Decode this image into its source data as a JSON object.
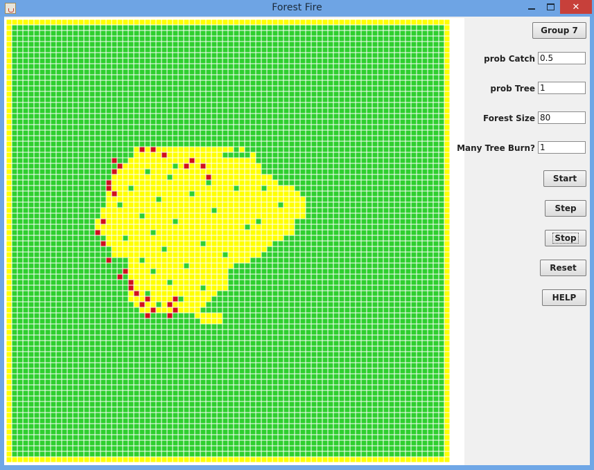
{
  "window": {
    "title": "Forest Fire",
    "close_glyph": "✕"
  },
  "icons": {
    "app": "java-cup-icon",
    "minimize": "minimize-icon",
    "maximize": "maximize-icon",
    "close": "close-icon"
  },
  "colors": {
    "tree": "#2fcf2f",
    "empty": "#ffff00",
    "burning": "#d0101c",
    "grid_line": "#ffffff"
  },
  "controls": {
    "group_button": "Group 7",
    "prob_catch": {
      "label": "prob Catch",
      "value": "0.5"
    },
    "prob_tree": {
      "label": "prob Tree",
      "value": "1"
    },
    "forest_size": {
      "label": "Forest Size",
      "value": "80"
    },
    "many_tree_burn": {
      "label": "Many Tree Burn?",
      "value": "1"
    },
    "start_button": "Start",
    "step_button": "Step",
    "stop_button": "Stop",
    "reset_button": "Reset",
    "help_button": "HELP"
  },
  "forest": {
    "size": 80,
    "burnt_rows": [
      [
        23,
        23,
        40,
        42
      ],
      [
        24,
        23,
        38,
        44
      ],
      [
        25,
        22,
        44
      ],
      [
        26,
        21,
        45
      ],
      [
        27,
        19,
        45
      ],
      [
        28,
        19,
        47
      ],
      [
        29,
        18,
        48
      ],
      [
        30,
        18,
        51
      ],
      [
        31,
        18,
        52
      ],
      [
        32,
        18,
        53
      ],
      [
        33,
        18,
        53
      ],
      [
        34,
        17,
        53
      ],
      [
        35,
        17,
        53
      ],
      [
        36,
        16,
        51
      ],
      [
        37,
        16,
        51
      ],
      [
        38,
        17,
        51
      ],
      [
        39,
        18,
        49
      ],
      [
        40,
        18,
        47
      ],
      [
        41,
        19,
        46
      ],
      [
        42,
        19,
        45
      ],
      [
        43,
        22,
        43
      ],
      [
        44,
        22,
        40
      ],
      [
        45,
        22,
        39
      ],
      [
        46,
        22,
        39
      ],
      [
        47,
        22,
        39
      ],
      [
        48,
        22,
        39
      ],
      [
        49,
        22,
        37
      ],
      [
        50,
        22,
        36
      ],
      [
        51,
        23,
        35
      ],
      [
        52,
        24,
        34
      ],
      [
        53,
        34,
        38
      ],
      [
        54,
        35,
        38
      ]
    ],
    "burnt_trees": [
      [
        26,
        30
      ],
      [
        27,
        25
      ],
      [
        28,
        29
      ],
      [
        29,
        36
      ],
      [
        30,
        22
      ],
      [
        30,
        41
      ],
      [
        31,
        33
      ],
      [
        32,
        27
      ],
      [
        33,
        20
      ],
      [
        34,
        37
      ],
      [
        35,
        24
      ],
      [
        36,
        30
      ],
      [
        37,
        43
      ],
      [
        38,
        26
      ],
      [
        39,
        21
      ],
      [
        40,
        35
      ],
      [
        41,
        28
      ],
      [
        42,
        39
      ],
      [
        43,
        24
      ],
      [
        44,
        32
      ],
      [
        45,
        26
      ],
      [
        47,
        29
      ],
      [
        48,
        35
      ],
      [
        49,
        25
      ],
      [
        50,
        31
      ],
      [
        51,
        27
      ],
      [
        52,
        30
      ],
      [
        30,
        46
      ],
      [
        33,
        49
      ],
      [
        36,
        45
      ]
    ],
    "burning": [
      [
        23,
        24
      ],
      [
        23,
        26
      ],
      [
        24,
        28
      ],
      [
        25,
        19
      ],
      [
        25,
        33
      ],
      [
        26,
        20
      ],
      [
        26,
        32
      ],
      [
        26,
        35
      ],
      [
        27,
        19
      ],
      [
        28,
        36
      ],
      [
        29,
        18
      ],
      [
        30,
        18
      ],
      [
        31,
        19
      ],
      [
        36,
        17
      ],
      [
        38,
        16
      ],
      [
        40,
        17
      ],
      [
        43,
        18
      ],
      [
        45,
        21
      ],
      [
        46,
        20
      ],
      [
        47,
        22
      ],
      [
        48,
        22
      ],
      [
        49,
        23
      ],
      [
        50,
        25
      ],
      [
        51,
        24
      ],
      [
        52,
        26
      ],
      [
        53,
        25
      ],
      [
        53,
        29
      ],
      [
        52,
        30
      ],
      [
        51,
        29
      ],
      [
        50,
        30
      ]
    ]
  }
}
